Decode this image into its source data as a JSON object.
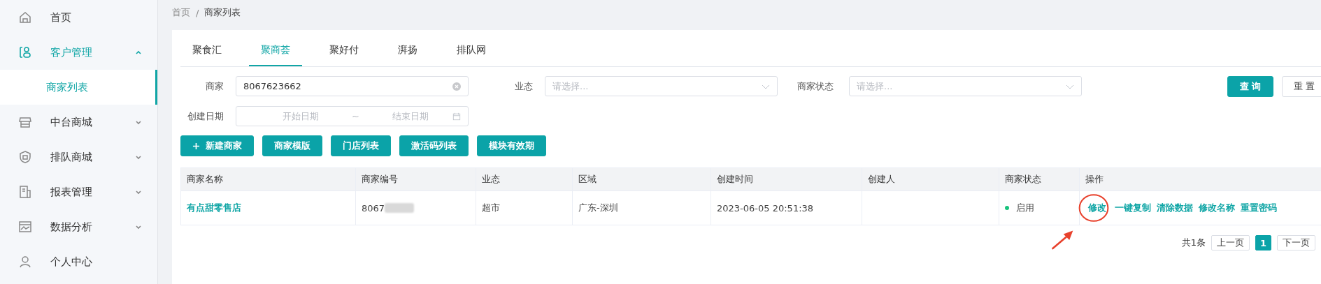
{
  "sidebar": {
    "items": [
      {
        "label": "首页",
        "selected": false
      },
      {
        "label": "客户管理",
        "selected": true,
        "expanded": true,
        "children": [
          {
            "label": "商家列表",
            "selected": true
          }
        ]
      },
      {
        "label": "中台商城",
        "selected": false,
        "expanded": false
      },
      {
        "label": "排队商城",
        "selected": false,
        "expanded": false
      },
      {
        "label": "报表管理",
        "selected": false,
        "expanded": false
      },
      {
        "label": "数据分析",
        "selected": false,
        "expanded": false
      },
      {
        "label": "个人中心",
        "selected": false
      }
    ]
  },
  "breadcrumb": {
    "separator": "/",
    "items": [
      "首页",
      "商家列表"
    ]
  },
  "tabs": [
    {
      "label": "聚食汇",
      "selected": false
    },
    {
      "label": "聚商荟",
      "selected": true
    },
    {
      "label": "聚好付",
      "selected": false
    },
    {
      "label": "湃扬",
      "selected": false
    },
    {
      "label": "排队网",
      "selected": false
    }
  ],
  "filters": {
    "merchant": {
      "label": "商家",
      "value": "8067623662"
    },
    "business_type": {
      "label": "业态",
      "placeholder": "请选择..."
    },
    "merchant_status": {
      "label": "商家状态",
      "placeholder": "请选择..."
    },
    "created_date": {
      "label": "创建日期",
      "start_placeholder": "开始日期",
      "separator": "~",
      "end_placeholder": "结束日期"
    },
    "query_button": "查 询",
    "reset_button": "重 置"
  },
  "actions": [
    {
      "label": "新建商家",
      "kind": "add"
    },
    {
      "label": "商家模版",
      "kind": "plain"
    },
    {
      "label": "门店列表",
      "kind": "plain"
    },
    {
      "label": "激活码列表",
      "kind": "plain"
    },
    {
      "label": "模块有效期",
      "kind": "plain"
    }
  ],
  "table": {
    "columns": [
      "商家名称",
      "商家编号",
      "业态",
      "区域",
      "创建时间",
      "创建人",
      "商家状态",
      "操作"
    ],
    "rows": [
      {
        "name": "有点甜零售店",
        "merchant_no": "8067",
        "business_type": "超市",
        "region": "广东-深圳",
        "created_at": "2023-06-05 20:51:38",
        "status": "启用",
        "enabled": true,
        "operations": [
          "修改",
          "一键复制",
          "清除数据",
          "修改名称",
          "重置密码"
        ]
      }
    ]
  },
  "pagination": {
    "total": "共1条",
    "prev": "上一页",
    "pages": [
      {
        "label": "1",
        "selected": true
      }
    ],
    "next": "下一页"
  }
}
